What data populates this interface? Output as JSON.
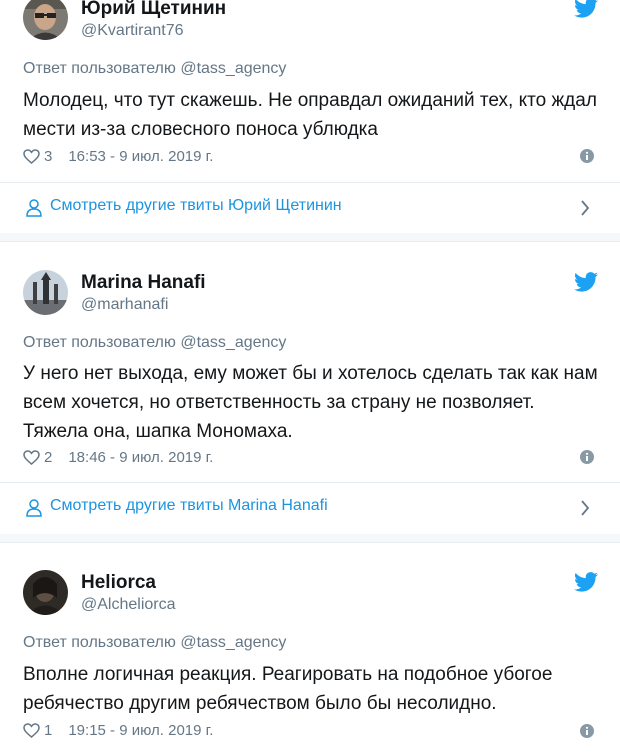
{
  "tweets": [
    {
      "author_name": "Юрий Щетинин",
      "author_handle": "@Kvartirant76",
      "reply_to": "Ответ пользователю @tass_agency",
      "text": "Молодец, что тут скажешь. Не оправдал ожиданий тех, кто ждал мести из-за словесного поноса ублюдка",
      "likes": "3",
      "timestamp": "16:53 - 9 июл. 2019 г.",
      "more_link": "Смотреть другие твиты Юрий Щетинин",
      "avatar_icon": "user-avatar"
    },
    {
      "author_name": "Marina Hanafi",
      "author_handle": "@marhanafi",
      "reply_to": "Ответ пользователю @tass_agency",
      "text": "У него нет выхода, ему может бы и хотелось сделать так как нам всем хочется, но ответственность за страну не позволяет. Тяжела она, шапка Мономаха.",
      "likes": "2",
      "timestamp": "18:46 - 9 июл. 2019 г.",
      "more_link": "Смотреть другие твиты Marina Hanafi",
      "avatar_icon": "user-avatar"
    },
    {
      "author_name": "Heliorca",
      "author_handle": "@Alcheliorca",
      "reply_to": "Ответ пользователю @tass_agency",
      "text": "Вполне логичная реакция. Реагировать на подобное убогое ребячество другим ребячеством было бы несолидно.",
      "likes": "1",
      "timestamp": "19:15 - 9 июл. 2019 г.",
      "avatar_icon": "user-avatar"
    }
  ],
  "icons": {
    "twitter": "twitter-bird-icon",
    "like": "heart-icon",
    "info": "info-icon",
    "person": "person-icon",
    "chevron": "chevron-right-icon"
  },
  "colors": {
    "twitter_blue": "#1da1f2",
    "link_blue": "#1b95e0",
    "text_primary": "#14171a",
    "text_secondary": "#657786",
    "divider": "#e6ecf0",
    "separator_bg": "#f5f8fa"
  }
}
